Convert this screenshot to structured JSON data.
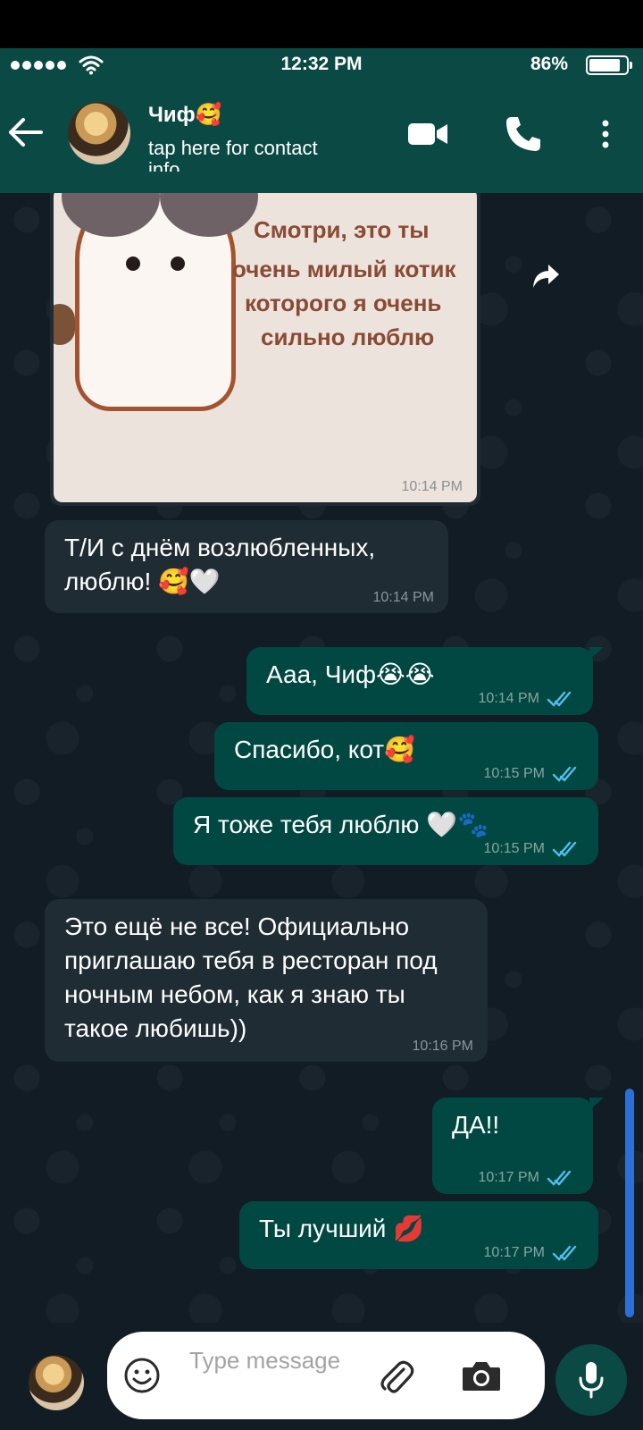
{
  "status_bar": {
    "time": "12:32 PM",
    "battery": "86%",
    "battery_level": 0.86
  },
  "header": {
    "name": "Чиф🥰",
    "subtitle": "tap here for contact info"
  },
  "sticker": {
    "lines": [
      "Смотри, это ты",
      "очень милый котик",
      "которого я очень",
      "сильно люблю"
    ],
    "time": "10:14 PM"
  },
  "messages": [
    {
      "dir": "in",
      "text": "Т/И с днём возлюбленных, люблю! 🥰🤍",
      "time": "10:14 PM"
    },
    {
      "dir": "out",
      "text": "Ааа, Чиф😭😭",
      "time": "10:14 PM"
    },
    {
      "dir": "out",
      "text": "Спасибо, кот🥰",
      "time": "10:15 PM"
    },
    {
      "dir": "out",
      "text": "Я тоже тебя люблю 🤍🐾",
      "time": "10:15 PM"
    },
    {
      "dir": "in",
      "text": "Это ещё не все! Официально приглашаю тебя в ресторан под ночным небом, как я знаю ты такое любишь))",
      "time": "10:16 PM"
    },
    {
      "dir": "out",
      "text": "ДА!!",
      "time": "10:17 PM"
    },
    {
      "dir": "out",
      "text": "Ты лучший 💋",
      "time": "10:17 PM"
    }
  ],
  "input": {
    "placeholder": "Type message"
  },
  "colors": {
    "header": "#0b4a44",
    "incoming": "#1f2c34",
    "outgoing": "#014842",
    "ticks": "#53bdeb"
  },
  "icons": [
    "back-arrow-icon",
    "video-call-icon",
    "phone-icon",
    "more-vert-icon",
    "forward-icon",
    "read-ticks-icon",
    "emoji-icon",
    "paperclip-icon",
    "camera-icon",
    "mic-icon"
  ]
}
